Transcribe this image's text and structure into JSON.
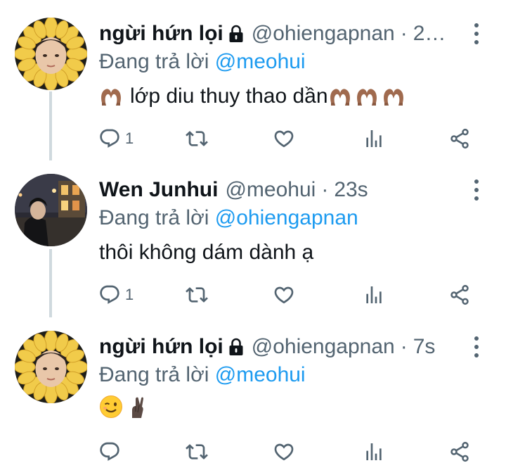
{
  "colors": {
    "text": "#0f1419",
    "secondary": "#536471",
    "link": "#1d9bf0",
    "thread_line": "#cfd9de"
  },
  "tweets": [
    {
      "display_name": "ngừi hứn lọi",
      "protected": true,
      "handle": "@ohiengapnan",
      "separator": "·",
      "time": "2…",
      "reply_prefix": "Đang trả lời",
      "reply_to": "@meohui",
      "text": "lớp diu thuy thao dần",
      "leading_emoji": "heart-hands-emoji",
      "trailing_emoji": [
        "heart-hands-emoji",
        "heart-hands-emoji",
        "heart-hands-emoji"
      ],
      "reply_count": "1",
      "avatar": "sunflower-avatar"
    },
    {
      "display_name": "Wen Junhui",
      "protected": false,
      "handle": "@meohui",
      "separator": "·",
      "time": "23s",
      "reply_prefix": "Đang trả lời",
      "reply_to": "@ohiengapnan",
      "text": "thôi không dám dành ạ",
      "reply_count": "1",
      "avatar": "night-street-avatar"
    },
    {
      "display_name": "ngừi hứn lọi",
      "protected": true,
      "handle": "@ohiengapnan",
      "separator": "·",
      "time": "7s",
      "reply_prefix": "Đang trả lời",
      "reply_to": "@meohui",
      "text": "",
      "emojis": [
        "winking-face-emoji",
        "crossed-fingers-emoji"
      ],
      "reply_count": "",
      "avatar": "sunflower-avatar"
    }
  ],
  "icons": {
    "reply": "reply-icon",
    "retweet": "retweet-icon",
    "like": "heart-icon",
    "views": "analytics-icon",
    "share": "share-icon",
    "more": "more-vertical-icon",
    "lock": "lock-icon"
  }
}
